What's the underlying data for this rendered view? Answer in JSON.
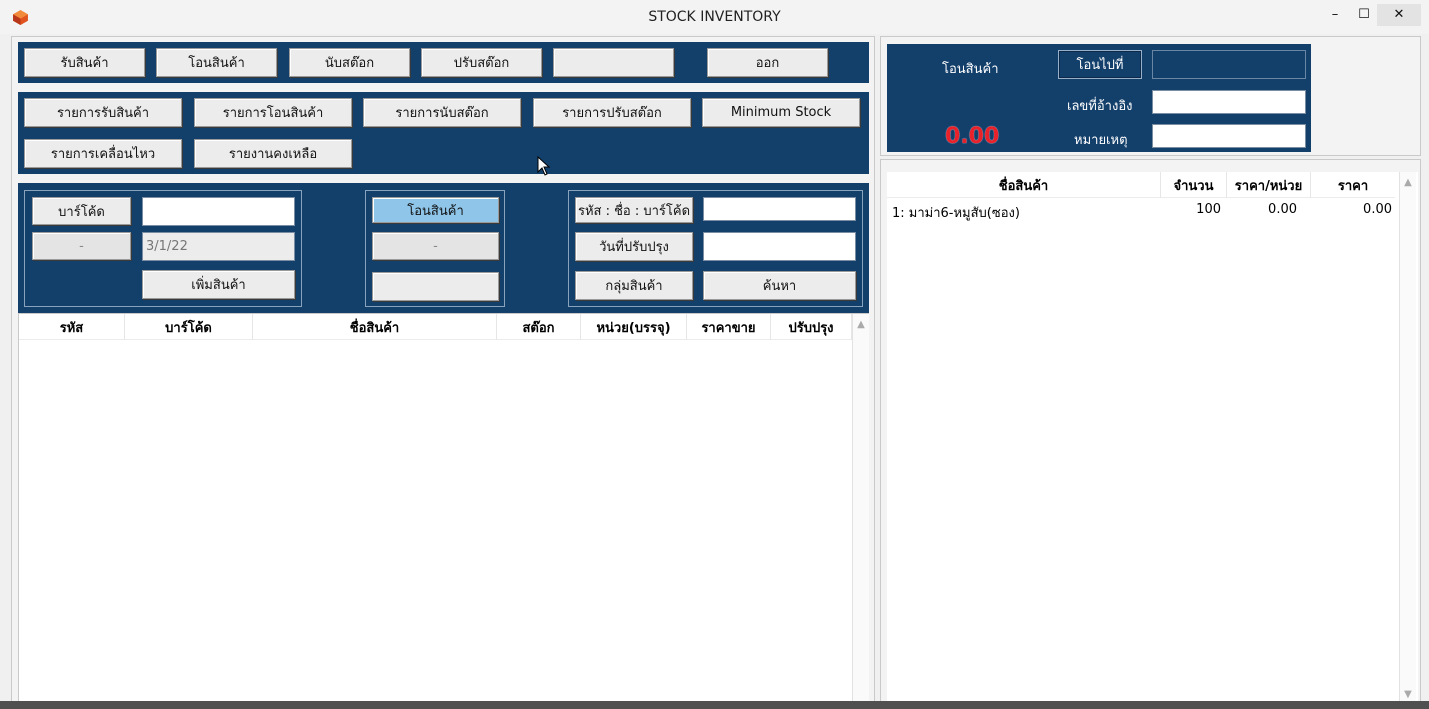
{
  "window": {
    "title": "STOCK INVENTORY",
    "minimize": "–",
    "maximize": "☐",
    "close": "✕"
  },
  "toolbar1": {
    "receive": "รับสินค้า",
    "transfer": "โอนสินค้า",
    "count": "นับสต๊อก",
    "adjust": "ปรับสต๊อก",
    "blank": "",
    "exit": "ออก"
  },
  "toolbar2": {
    "receive_list": "รายการรับสินค้า",
    "transfer_list": "รายการโอนสินค้า",
    "count_list": "รายการนับสต๊อก",
    "adjust_list": "รายการปรับสต๊อก",
    "minimum_stock": "Minimum Stock",
    "movement_list": "รายการเคลื่อนไหว",
    "remaining_report": "รายงานคงเหลือ"
  },
  "entry": {
    "barcode_button": "บาร์โค้ด",
    "barcode_value": "",
    "dash_button": "-",
    "date_value": "3/1/22",
    "add_item": "เพิ่มสินค้า"
  },
  "mode": {
    "transfer": "โอนสินค้า",
    "dash": "-",
    "blank": ""
  },
  "search": {
    "code_name_barcode": "รหัส : ชื่อ : บาร์โค้ด",
    "code_value": "",
    "update_date": "วันที่ปรับปรุง",
    "date_value": "",
    "product_group": "กลุ่มสินค้า",
    "search_button": "ค้นหา"
  },
  "product_table": {
    "columns": [
      "รหัส",
      "บาร์โค้ด",
      "ชื่อสินค้า",
      "สต๊อก",
      "หน่วย(บรรจุ)",
      "ราคาขาย",
      "ปรับปรุง"
    ],
    "rows": []
  },
  "transfer_panel": {
    "title": "โอนสินค้า",
    "transfer_to_button": "โอนไปที่",
    "transfer_to_value": "",
    "reference_label": "เลขที่อ้างอิง",
    "reference_value": "",
    "note_label": "หมายเหตุ",
    "note_value": "",
    "total": "0.00",
    "total_color": "#e8212a"
  },
  "transfer_table": {
    "columns": [
      "ชื่อสินค้า",
      "จำนวน",
      "ราคา/หน่วย",
      "ราคา"
    ],
    "rows": [
      {
        "name": "1: มาม่า6-หมูสับ(ซอง)",
        "qty": "100",
        "unit_price": "0.00",
        "price": "0.00"
      }
    ]
  },
  "colors": {
    "panel": "#133f6b",
    "selected": "#8ec5e9"
  }
}
